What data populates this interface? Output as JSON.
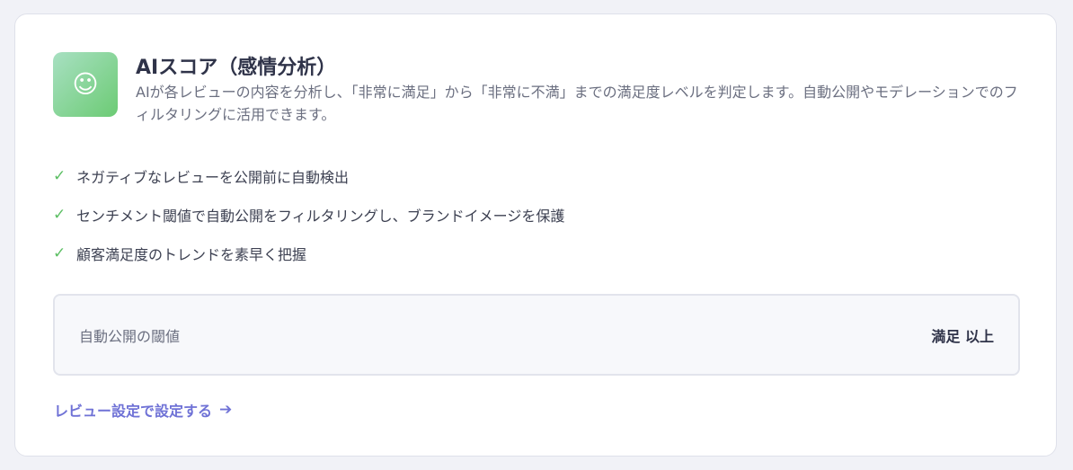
{
  "feature": {
    "icon": "smiley-face-icon",
    "title": "AIスコア（感情分析）",
    "description": "AIが各レビューの内容を分析し、「非常に満足」から「非常に不満」までの満足度レベルを判定します。自動公開やモデレーションでのフィルタリングに活用できます。"
  },
  "bullets": [
    "ネガティブなレビューを公開前に自動検出",
    "センチメント閾値で自動公開をフィルタリングし、ブランドイメージを保護",
    "顧客満足度のトレンドを素早く把握"
  ],
  "check_glyph": "✓",
  "threshold": {
    "label": "自動公開の閾値",
    "value": "満足 以上"
  },
  "link": {
    "label": "レビュー設定で設定する",
    "arrow": "➔"
  },
  "colors": {
    "accent": "#6f72d6",
    "check": "#5cbf63",
    "icon_gradient_start": "#a8e0c2",
    "icon_gradient_end": "#6ccb74"
  }
}
